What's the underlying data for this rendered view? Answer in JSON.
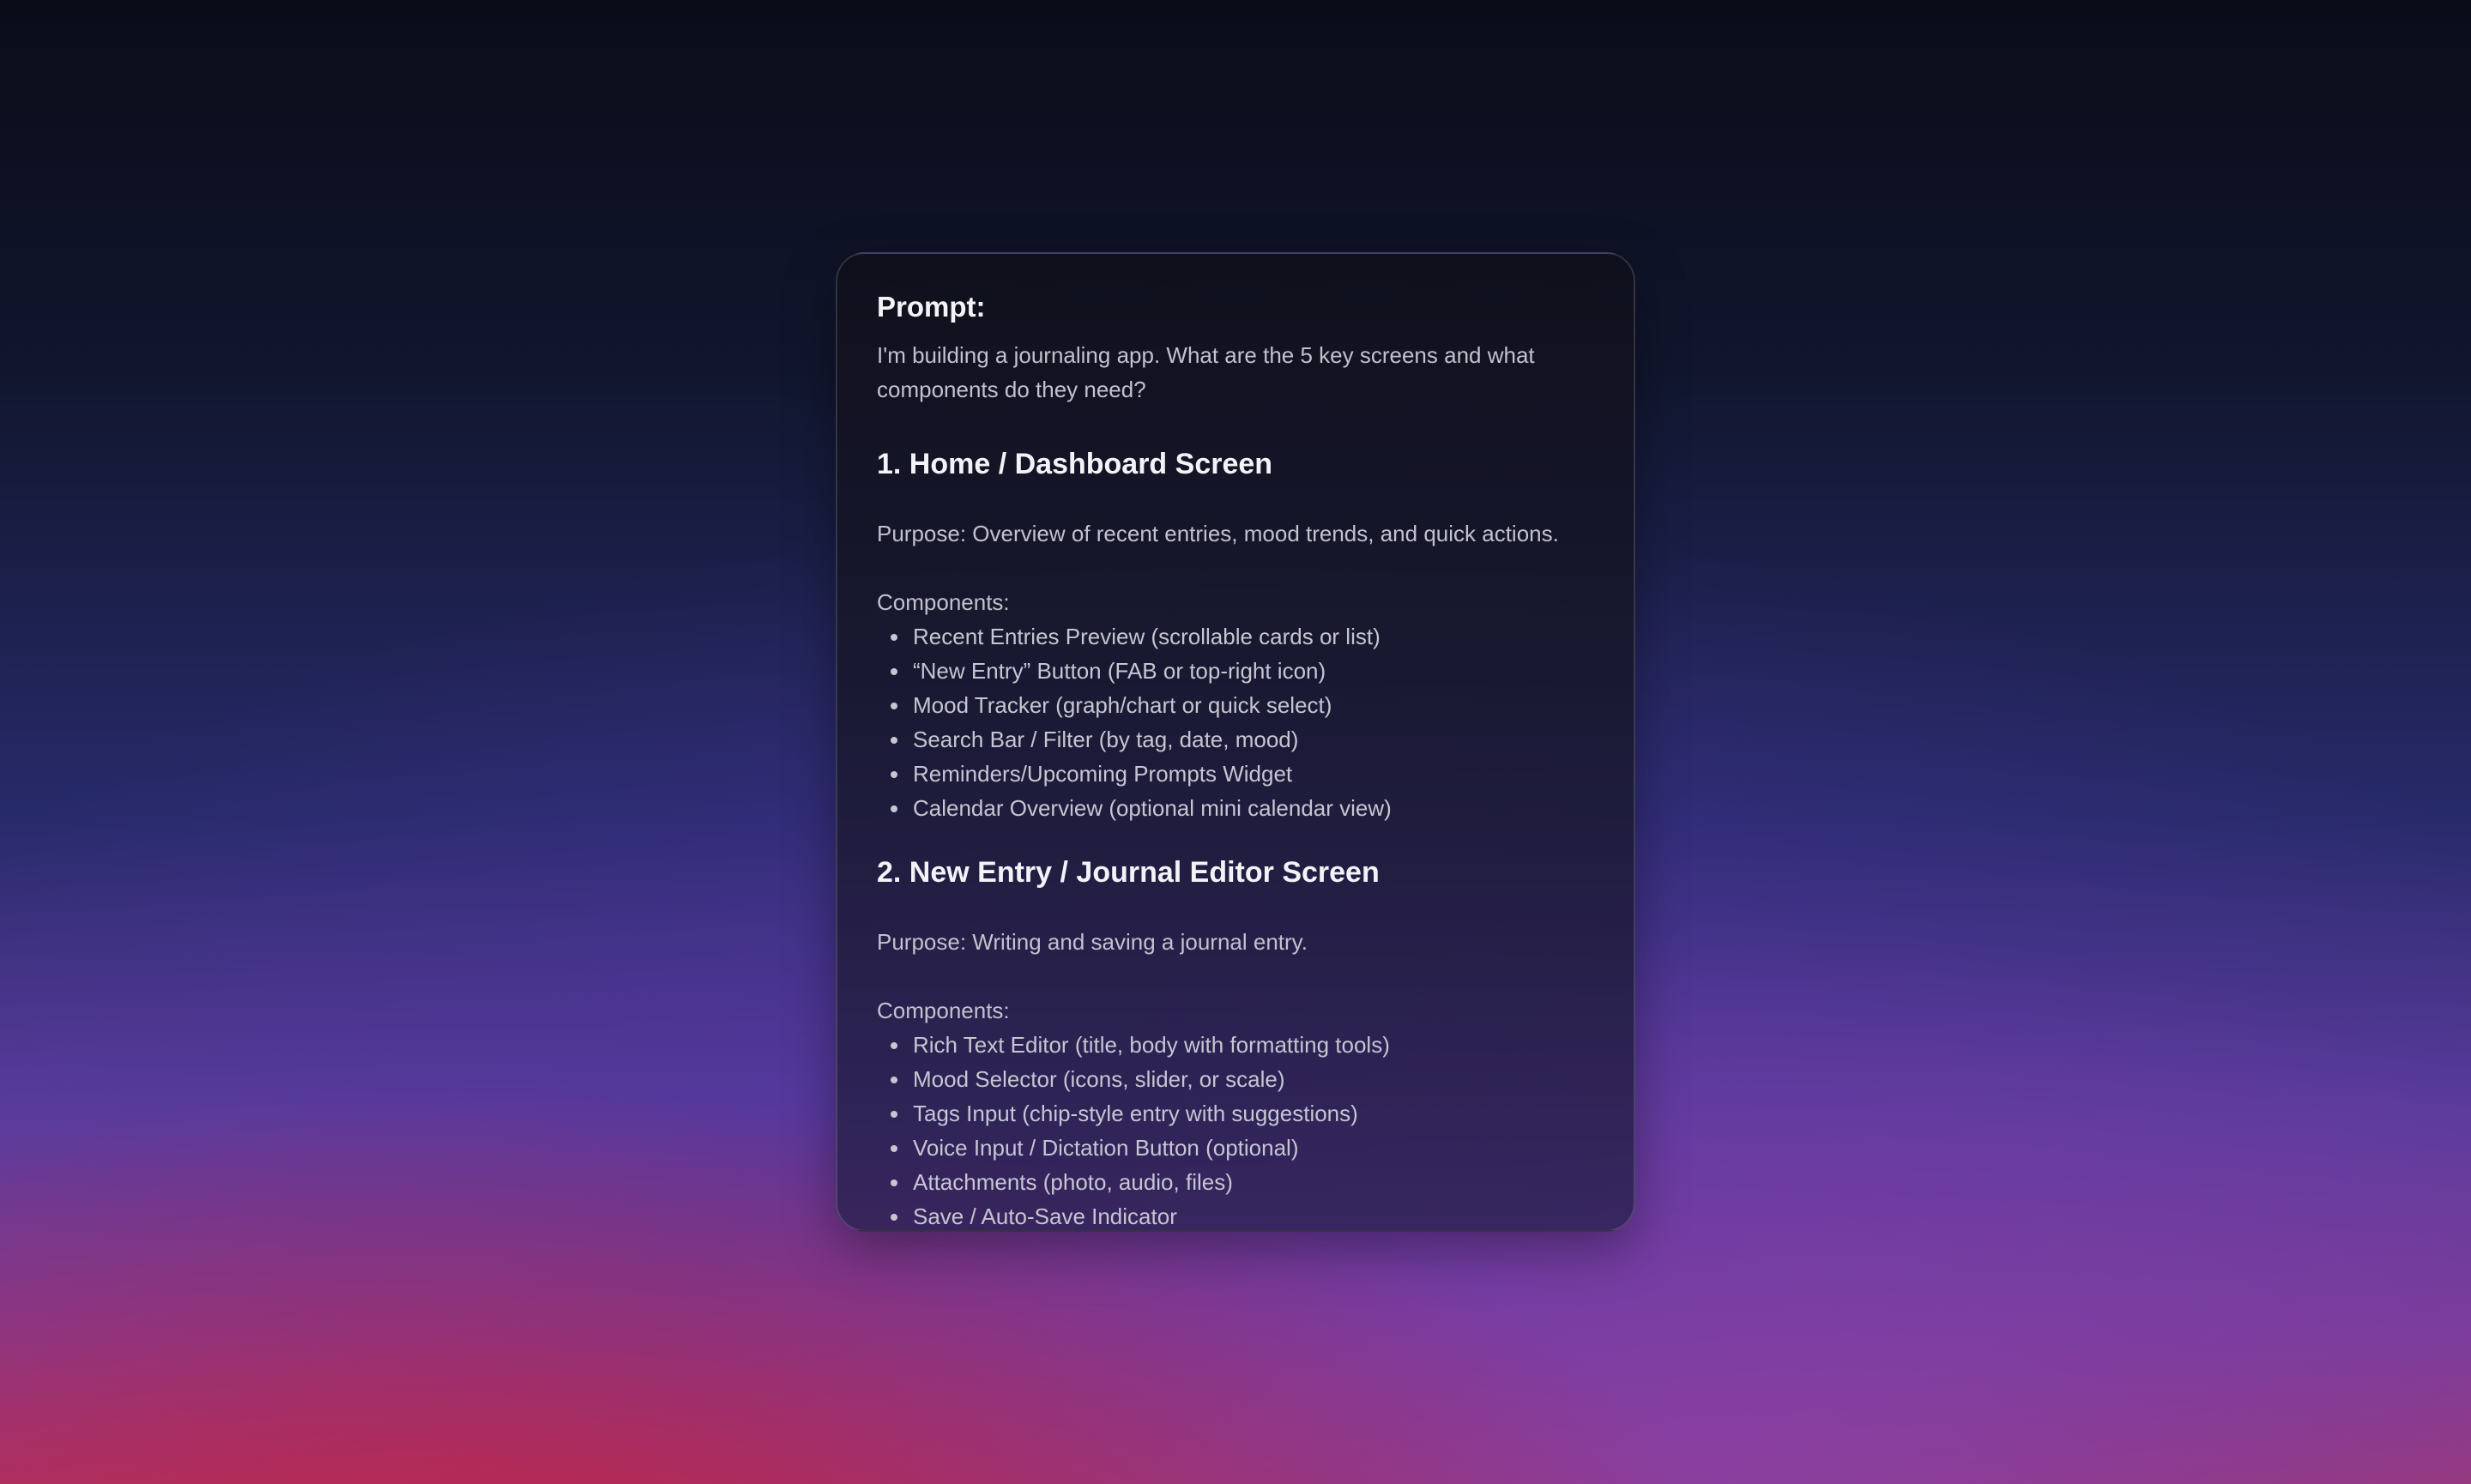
{
  "card": {
    "prompt_label": "Prompt:",
    "prompt_text": "I'm building a journaling app. What are the 5 key screens and what components do they need?",
    "sections": [
      {
        "title": "1. Home / Dashboard Screen",
        "purpose": "Purpose: Overview of recent entries, mood trends, and quick actions.",
        "components_label": "Components:",
        "items": [
          "Recent Entries Preview (scrollable cards or list)",
          "“New Entry” Button (FAB or top-right icon)",
          "Mood Tracker (graph/chart or quick select)",
          "Search Bar / Filter (by tag, date, mood)",
          "Reminders/Upcoming Prompts Widget",
          "Calendar Overview (optional mini calendar view)"
        ]
      },
      {
        "title": "2. New Entry / Journal Editor Screen",
        "purpose": "Purpose: Writing and saving a journal entry.",
        "components_label": "Components:",
        "items": [
          "Rich Text Editor (title, body with formatting tools)",
          "Mood Selector (icons, slider, or scale)",
          "Tags Input (chip-style entry with suggestions)",
          "Voice Input / Dictation Button (optional)",
          "Attachments (photo, audio, files)",
          "Save / Auto-Save Indicator"
        ]
      }
    ]
  }
}
